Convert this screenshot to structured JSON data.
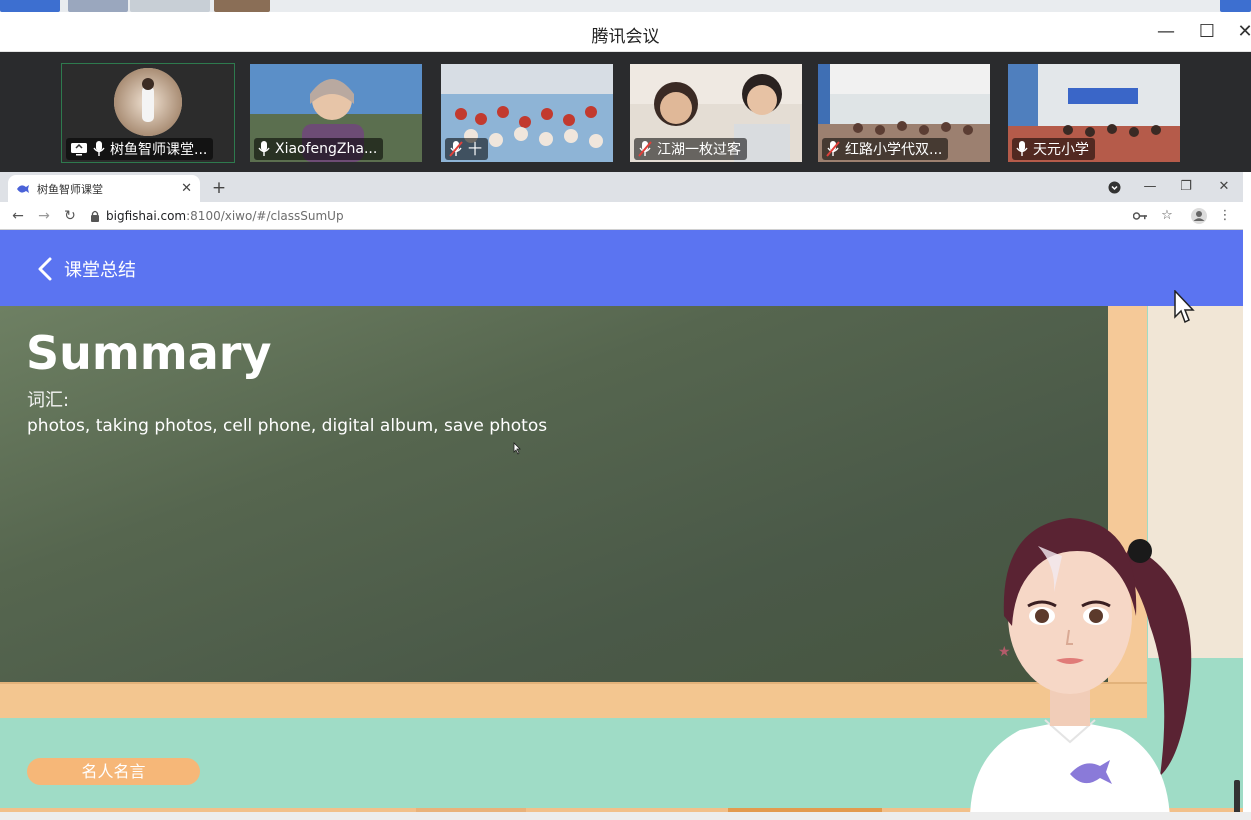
{
  "meeting": {
    "title": "腾讯会议",
    "controls": {
      "minimize": "—",
      "maximize": "☐",
      "close": "✕"
    }
  },
  "participants": [
    {
      "name": "树鱼智师课堂...",
      "mic": "on",
      "sharing": true,
      "active": true
    },
    {
      "name": "XiaofengZha...",
      "mic": "on"
    },
    {
      "name": "十",
      "mic": "muted"
    },
    {
      "name": "江湖一枚过客",
      "mic": "muted"
    },
    {
      "name": "红路小学代双...",
      "mic": "muted"
    },
    {
      "name": "天元小学",
      "mic": "on"
    }
  ],
  "browser": {
    "tab_title": "树鱼智师课堂",
    "tab_close": "✕",
    "new_tab": "+",
    "url_host": "bigfishai.com",
    "url_rest": ":8100/xiwo/#/classSumUp",
    "nav": {
      "back": "←",
      "forward": "→",
      "reload": "↻"
    },
    "window_controls": {
      "minimize": "—",
      "restore": "❐",
      "close": "✕"
    }
  },
  "app": {
    "header_title": "课堂总结",
    "summary_title": "Summary",
    "vocab_label": "词汇:",
    "vocab_text": "photos, taking photos, cell phone, digital album, save photos",
    "quote_button": "名人名言"
  },
  "colors": {
    "header_blue": "#5b74f1",
    "board_green": "#56664f",
    "frame_orange": "#f5c998",
    "wall_mint": "#9fdcc6",
    "quote_button": "#f6b778"
  }
}
